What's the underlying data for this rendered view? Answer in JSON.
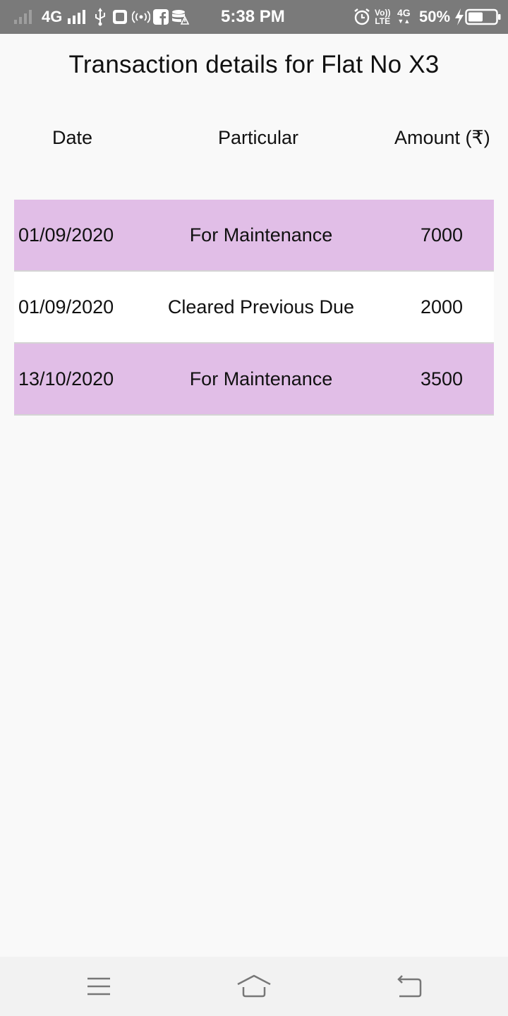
{
  "status_bar": {
    "network": "4G",
    "time": "5:38 PM",
    "volte": "Vo))",
    "lte": "LTE",
    "network2": "4G",
    "battery": "50%",
    "icons": [
      "signal-weak-icon",
      "signal-strong-icon",
      "usb-icon",
      "photo-icon",
      "hotspot-icon",
      "facebook-icon",
      "database-icon",
      "alarm-icon",
      "charging-icon",
      "battery-icon"
    ]
  },
  "page": {
    "title": "Transaction details for Flat No X3"
  },
  "table": {
    "headers": {
      "date": "Date",
      "particular": "Particular",
      "amount": "Amount (₹)"
    },
    "rows": [
      {
        "date": "01/09/2020",
        "particular": "For Maintenance",
        "amount": "7000"
      },
      {
        "date": "01/09/2020",
        "particular": "Cleared Previous Due",
        "amount": "2000"
      },
      {
        "date": "13/10/2020",
        "particular": "For Maintenance",
        "amount": "3500"
      }
    ]
  },
  "nav_bar": {
    "icons": [
      "menu-icon",
      "home-icon",
      "back-icon"
    ]
  },
  "colors": {
    "status_bar_bg": "#7a7a7a",
    "row_highlight": "#e1bee7",
    "row_plain": "#ffffff",
    "page_bg": "#f9f9f9"
  }
}
